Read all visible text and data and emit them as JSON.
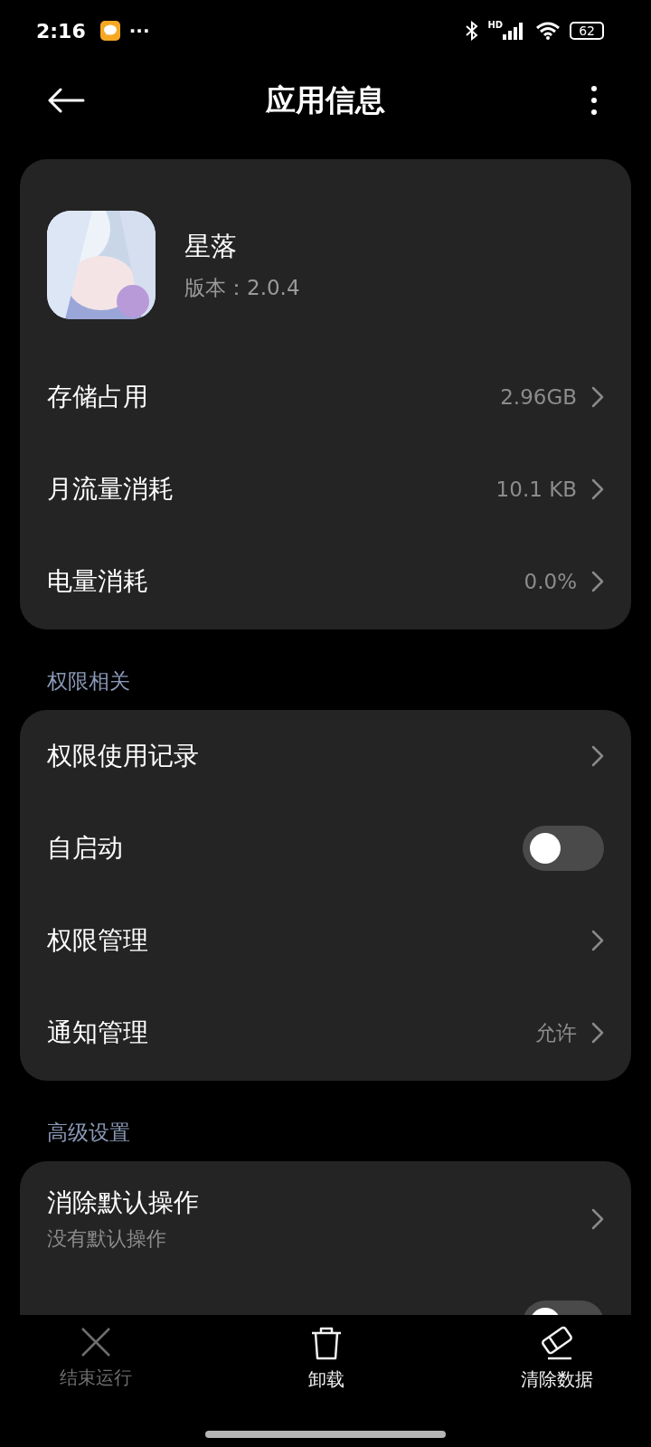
{
  "status_bar": {
    "time": "2:16",
    "more": "···",
    "hd": "HD",
    "battery": "62"
  },
  "header": {
    "title": "应用信息"
  },
  "app": {
    "name": "星落",
    "version": "版本：2.0.4"
  },
  "app_rows": [
    {
      "kind": "link",
      "label": "存储占用",
      "value": "2.96GB"
    },
    {
      "kind": "link",
      "label": "月流量消耗",
      "value": "10.1 KB"
    },
    {
      "kind": "link",
      "label": "电量消耗",
      "value": "0.0%"
    }
  ],
  "sections": [
    {
      "title": "权限相关",
      "rows": [
        {
          "kind": "link",
          "label": "权限使用记录"
        },
        {
          "kind": "toggle",
          "label": "自启动",
          "on": false
        },
        {
          "kind": "link",
          "label": "权限管理"
        },
        {
          "kind": "link",
          "label": "通知管理",
          "value": "允许"
        }
      ]
    },
    {
      "title": "高级设置",
      "rows": [
        {
          "kind": "link",
          "label": "消除默认操作",
          "subtitle": "没有默认操作"
        },
        {
          "kind": "toggle",
          "on": false
        }
      ]
    }
  ],
  "bottom_actions": [
    {
      "kind": "close",
      "label": "结束运行",
      "disabled": true
    },
    {
      "kind": "trash",
      "label": "卸载",
      "disabled": false
    },
    {
      "kind": "eraser",
      "label": "清除数据",
      "disabled": false
    }
  ]
}
